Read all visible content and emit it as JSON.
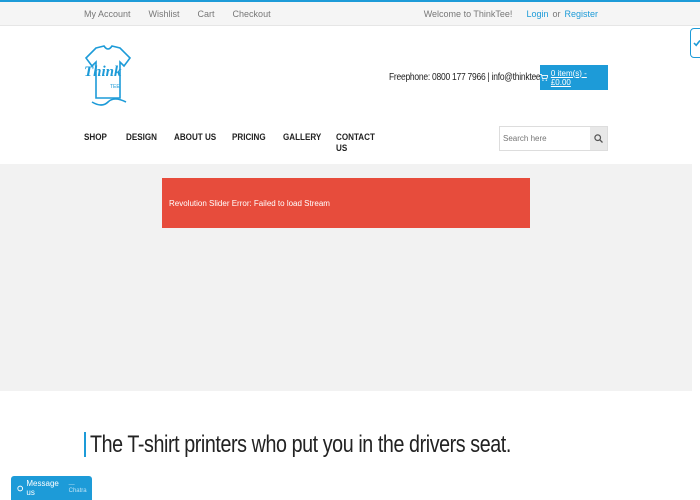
{
  "topbar": {
    "links": [
      "My Account",
      "Wishlist",
      "Cart",
      "Checkout"
    ],
    "welcome": "Welcome to ThinkTee!",
    "login": "Login",
    "or": "or",
    "register": "Register"
  },
  "header": {
    "logo_text": "Think",
    "logo_subtext": "TEE",
    "contact": "Freephone: 0800 177 7966 | info@thinktee.co.uk",
    "cart_label": "0 item(s) - £0.00",
    "nav": [
      "SHOP",
      "DESIGN",
      "ABOUT US",
      "PRICING",
      "GALLERY",
      "CONTACT US"
    ],
    "search_placeholder": "Search here"
  },
  "slider": {
    "error": "Revolution Slider Error: Failed to load Stream"
  },
  "content": {
    "tagline": "The T-shirt printers who put you in the drivers seat."
  },
  "chat": {
    "label": "Message us",
    "brand": "Chatra"
  },
  "colors": {
    "accent": "#1d9bd8",
    "error": "#e74c3c"
  }
}
